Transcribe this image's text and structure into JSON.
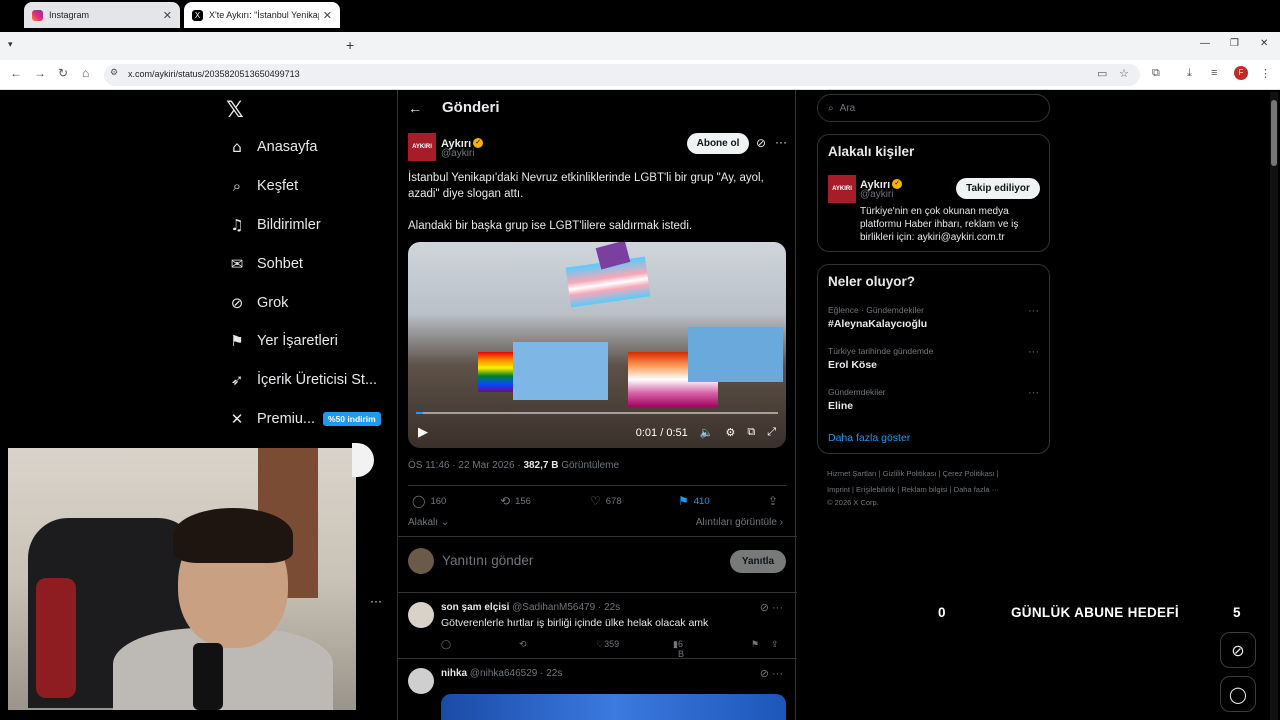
{
  "browser": {
    "tabs": [
      {
        "label": "Instagram",
        "favicon_color": "#e1306c"
      },
      {
        "label": "X'te Aykırı: \"İstanbul Yenikapı'da...",
        "favicon_color": "#000000"
      }
    ],
    "url": "x.com/aykiri/status/2035820513650499713"
  },
  "nav": {
    "items": [
      {
        "label": "Anasayfa",
        "icon": "home-icon"
      },
      {
        "label": "Keşfet",
        "icon": "search-icon"
      },
      {
        "label": "Bildirimler",
        "icon": "bell-icon"
      },
      {
        "label": "Sohbet",
        "icon": "mail-icon"
      },
      {
        "label": "Grok",
        "icon": "grok-icon"
      },
      {
        "label": "Yer İşaretleri",
        "icon": "bookmark-icon"
      },
      {
        "label": "İçerik Üreticisi St...",
        "icon": "rocket-icon"
      },
      {
        "label": "Premiu...",
        "icon": "x-logo-icon"
      }
    ],
    "premium_badge": "%50 indirim"
  },
  "post": {
    "header_title": "Gönderi",
    "author_name": "Aykırı",
    "author_handle": "@aykiri",
    "avatar_text": "AYKIRI",
    "subscribe_label": "Abone ol",
    "text_line1": "İstanbul Yenikapı'daki Nevruz etkinliklerinde LGBT'li bir grup \"Ay, ayol,",
    "text_line2": "azadi\" diye slogan attı.",
    "text_line3": "Alandaki bir başka grup ise LGBT'lilere saldırmak istedi.",
    "video_time": "0:01 / 0:51",
    "video_progress": 0.02,
    "meta_time": "ÖS 11:46 · 22 Mar 2026 · ",
    "meta_views": "382,7 B",
    "meta_views_label": " Görüntüleme",
    "replies": "160",
    "reposts": "156",
    "likes": "678",
    "bookmarks": "410",
    "related_label": "Alakalı",
    "quotes_label": "Alıntıları görüntüle",
    "reply_placeholder": "Yanıtını gönder",
    "reply_button": "Yanıtla"
  },
  "comments": [
    {
      "name": "son şam elçisi",
      "handle_time": "@SadihanM56479 · 22s",
      "text": "Götverenlerle hırtlar iş birliği içinde ülke helak olacak amk",
      "likes": "359",
      "views": "6 B"
    },
    {
      "name": "nihka",
      "handle_time": "@nihka646529 · 22s"
    }
  ],
  "sidebar": {
    "search_placeholder": "Ara",
    "related_title": "Alakalı kişiler",
    "follow_label": "Takip ediliyor",
    "bio": "Türkiye'nin en çok okunan medya platformu Haber ihbarı, reklam ve iş birlikleri için: aykiri@aykiri.com.tr",
    "trends_title": "Neler oluyor?",
    "trends": [
      {
        "category": "Eğlence · Gündemdekiler",
        "name": "#AleynaKalaycıoğlu"
      },
      {
        "category": "Türkiye tarihinde gündemde",
        "name": "Erol Köse"
      },
      {
        "category": "Gündemdekiler",
        "name": "Eline"
      }
    ],
    "show_more": "Daha fazla göster",
    "footer_line1": "Hizmet Şartları  |  Gizlilik Politikası  |  Çerez Politikası  |",
    "footer_line2": "Imprint  |  Erişilebilirlik  |  Reklam bilgisi  |  Daha fazla ···",
    "footer_line3": "© 2026 X Corp."
  },
  "overlay": {
    "goal_left": "0",
    "goal_text": "GÜNLÜK ABUNE HEDEFİ",
    "goal_right": "5"
  },
  "colors": {
    "accent": "#1d9bf0",
    "background": "#000000",
    "verified": "#f4b400",
    "brand": "#a81c2a"
  }
}
